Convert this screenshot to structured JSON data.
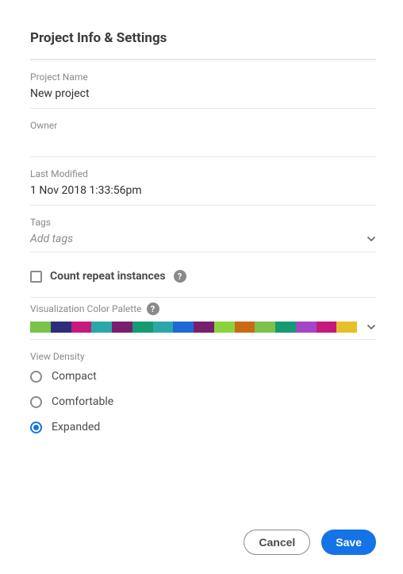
{
  "header": {
    "title": "Project Info & Settings"
  },
  "fields": {
    "projectName": {
      "label": "Project Name",
      "value": "New project"
    },
    "owner": {
      "label": "Owner",
      "value": ""
    },
    "lastModified": {
      "label": "Last Modified",
      "value": "1 Nov 2018 1:33:56pm"
    },
    "tags": {
      "label": "Tags",
      "placeholder": "Add tags"
    }
  },
  "countRepeat": {
    "label": "Count repeat instances",
    "checked": false
  },
  "palette": {
    "label": "Visualization Color Palette",
    "colors": [
      "#7cc24a",
      "#2b2e7a",
      "#c5197d",
      "#2aa8a8",
      "#7a1f6d",
      "#159a72",
      "#2aa8a8",
      "#1f69d6",
      "#7a1f6d",
      "#8bd23f",
      "#c96b15",
      "#7cc24a",
      "#159a72",
      "#a445c9",
      "#c5197d",
      "#e6c02a"
    ]
  },
  "viewDensity": {
    "label": "View Density",
    "options": [
      "Compact",
      "Comfortable",
      "Expanded"
    ],
    "selected": "Expanded"
  },
  "footer": {
    "cancel": "Cancel",
    "save": "Save"
  }
}
